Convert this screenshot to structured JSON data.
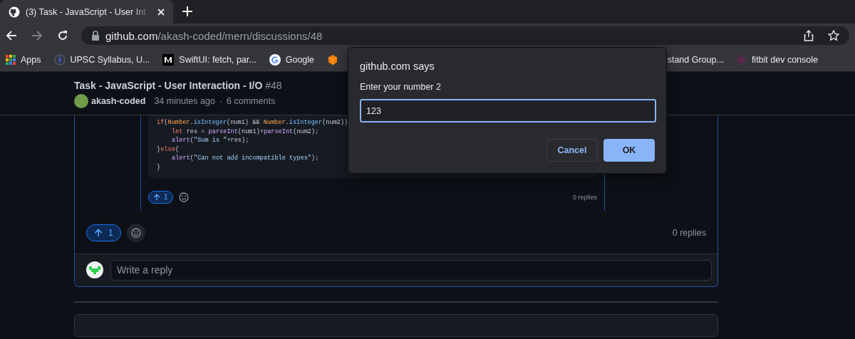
{
  "browser": {
    "tabs": [
      {
        "title": "(3) Task - JavaScript - User Int",
        "selected": true
      }
    ],
    "address": {
      "domain": "github.com",
      "path": "/akash-coded/mern/discussions/48"
    },
    "bookmarks": [
      {
        "label": "Apps",
        "kind": "apps"
      },
      {
        "label": "UPSC Syllabus, U...",
        "kind": "emblem"
      },
      {
        "label": "SwiftUI: fetch, par...",
        "kind": "medium"
      },
      {
        "label": "Google",
        "kind": "google"
      },
      {
        "kind": "cube"
      },
      {
        "label": "stand Group...",
        "kind": "none"
      },
      {
        "label": "fitbit dev console",
        "kind": "fitbit"
      }
    ]
  },
  "discussion": {
    "title": "Task - JavaScript - User Interaction - I/O",
    "number": "#48",
    "author": "akash-coded",
    "time": "34 minutes ago",
    "separator": "·",
    "comments": "6 comments"
  },
  "code_lines": [
    {
      "tokens": [
        {
          "t": "if",
          "kind": "kw"
        },
        {
          "t": "(",
          "kind": "p"
        },
        {
          "t": "Number",
          "kind": "obj"
        },
        {
          "t": ".",
          "kind": "p"
        },
        {
          "t": "isInteger",
          "kind": "prop"
        },
        {
          "t": "(num1) && ",
          "kind": "p"
        },
        {
          "t": "Number",
          "kind": "obj"
        },
        {
          "t": ".",
          "kind": "p"
        },
        {
          "t": "isInteger",
          "kind": "prop"
        },
        {
          "t": "(num2))",
          "kind": "p"
        }
      ],
      "children": [
        {
          "tokens": [
            {
              "t": "let",
              "kind": "kw"
            },
            {
              "t": " res = ",
              "kind": "p"
            },
            {
              "t": "parseInt",
              "kind": "fn"
            },
            {
              "t": "(num1)+",
              "kind": "p"
            },
            {
              "t": "parseInt",
              "kind": "fn"
            },
            {
              "t": "(num2);",
              "kind": "p"
            }
          ]
        },
        {
          "tokens": [
            {
              "t": "alert",
              "kind": "fn"
            },
            {
              "t": "(",
              "kind": "p"
            },
            {
              "t": "\"Sum is \"",
              "kind": "str"
            },
            {
              "t": "+res);",
              "kind": "p"
            }
          ]
        }
      ]
    },
    {
      "tokens": [
        {
          "t": "}",
          "kind": "p"
        },
        {
          "t": "else",
          "kind": "kw"
        },
        {
          "t": "{",
          "kind": "p"
        }
      ],
      "children": [
        {
          "tokens": [
            {
              "t": "alert",
              "kind": "fn"
            },
            {
              "t": "(",
              "kind": "p"
            },
            {
              "t": "\"Can not add incompatible types\"",
              "kind": "str"
            },
            {
              "t": ");",
              "kind": "p"
            }
          ]
        }
      ]
    },
    {
      "tokens": [
        {
          "t": "}",
          "kind": "p"
        }
      ]
    }
  ],
  "reply": {
    "upvotes": "1",
    "upvoted": true,
    "replies": "0 replies"
  },
  "comment": {
    "upvotes": "1",
    "upvoted": true,
    "replies": "0 replies"
  },
  "reply_box": {
    "placeholder": "Write a reply"
  },
  "dialog": {
    "title": "github.com says",
    "message": "Enter your number 2",
    "value": "123",
    "buttons": [
      {
        "label": "Cancel",
        "kind": "secondary"
      },
      {
        "label": "OK",
        "kind": "primary"
      }
    ]
  }
}
